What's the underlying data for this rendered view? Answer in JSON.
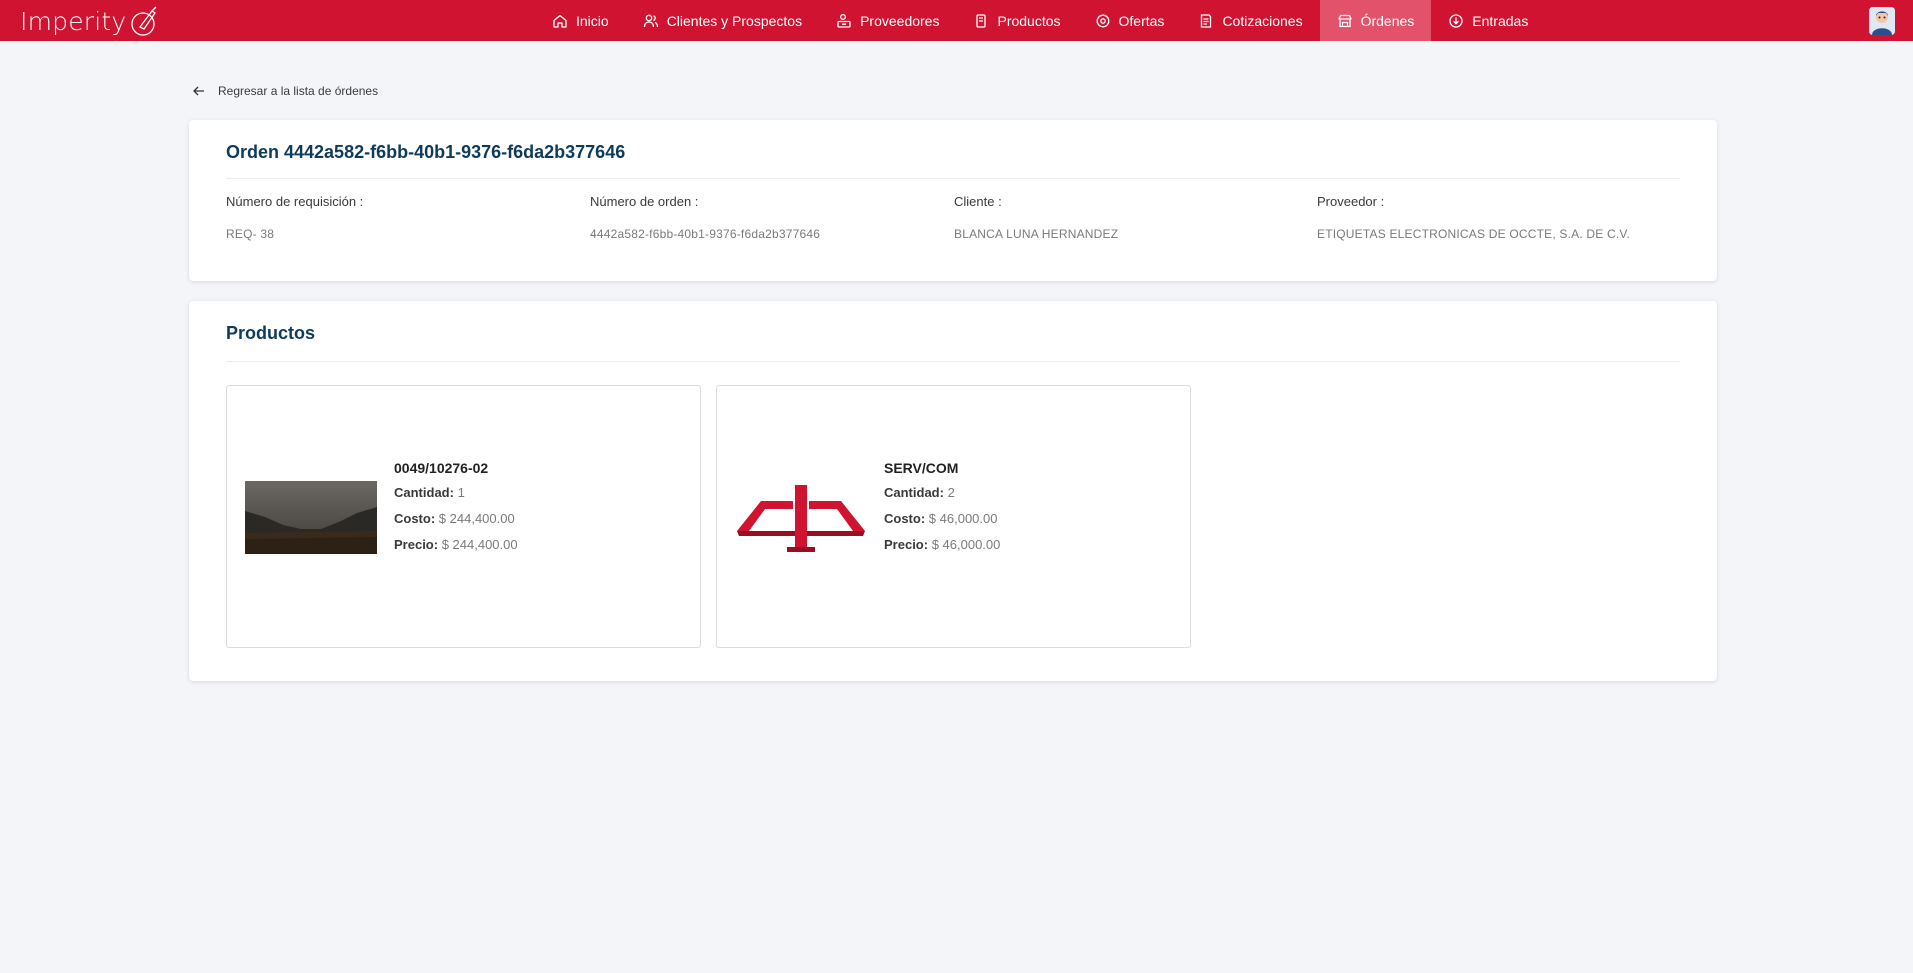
{
  "brand": {
    "name": "Imperity",
    "icon": "pen-brush-icon"
  },
  "nav": {
    "items": [
      {
        "label": "Inicio",
        "icon": "home-icon",
        "active": false
      },
      {
        "label": "Clientes y Prospectos",
        "icon": "users-icon",
        "active": false
      },
      {
        "label": "Proveedores",
        "icon": "supplier-icon",
        "active": false
      },
      {
        "label": "Productos",
        "icon": "box-icon",
        "active": false
      },
      {
        "label": "Ofertas",
        "icon": "offer-icon",
        "active": false
      },
      {
        "label": "Cotizaciones",
        "icon": "document-icon",
        "active": false
      },
      {
        "label": "Órdenes",
        "icon": "store-icon",
        "active": true
      },
      {
        "label": "Entradas",
        "icon": "download-circle-icon",
        "active": false
      }
    ],
    "avatar": "user-avatar"
  },
  "back_link": {
    "label": "Regresar a la lista de órdenes",
    "icon": "arrow-left-icon"
  },
  "order": {
    "title": "Orden 4442a582-f6bb-40b1-9376-f6da2b377646",
    "fields": [
      {
        "label": "Número de requisición :",
        "value": "REQ- 38"
      },
      {
        "label": "Número de orden :",
        "value": "4442a582-f6bb-40b1-9376-f6da2b377646"
      },
      {
        "label": "Cliente :",
        "value": "BLANCA LUNA HERNANDEZ"
      },
      {
        "label": "Proveedor :",
        "value": "ETIQUETAS ELECTRONICAS DE OCCTE, S.A. DE C.V."
      }
    ]
  },
  "products": {
    "title": "Productos",
    "labels": {
      "quantity": "Cantidad:",
      "cost": "Costo:",
      "price": "Precio:"
    },
    "items": [
      {
        "code": "0049/10276-02",
        "quantity": "1",
        "cost": "$ 244,400.00",
        "price": "$ 244,400.00",
        "image": "landscape-photo"
      },
      {
        "code": "SERV/COM",
        "quantity": "2",
        "cost": "$ 46,000.00",
        "price": "$ 46,000.00",
        "image": "red-scale-logo"
      }
    ]
  },
  "colors": {
    "primary": "#cf1330",
    "active_tab": "#e2526a",
    "title": "#0e3b5b",
    "background": "#f4f5f9"
  }
}
